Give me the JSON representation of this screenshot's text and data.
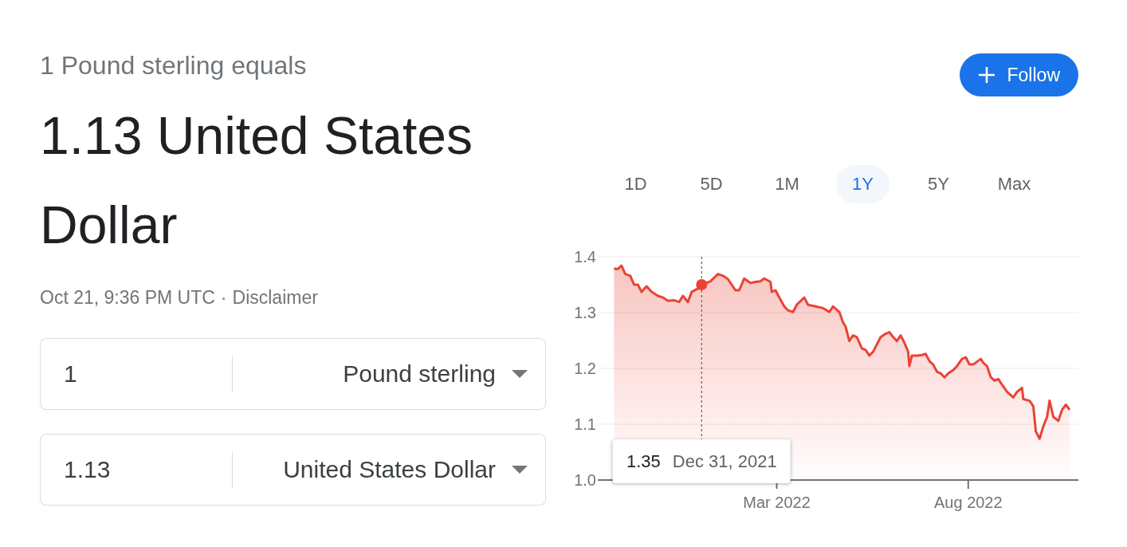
{
  "header": {
    "subtitle": "1 Pound sterling equals",
    "result": "1.13 United States Dollar",
    "updated": "Oct 21, 9:36 PM UTC",
    "separator": "·",
    "disclaimer": "Disclaimer"
  },
  "follow_button": {
    "label": "Follow"
  },
  "converter": [
    {
      "amount": "1",
      "currency": "Pound sterling"
    },
    {
      "amount": "1.13",
      "currency": "United States Dollar"
    }
  ],
  "range_tabs": [
    {
      "label": "1D",
      "selected": false
    },
    {
      "label": "5D",
      "selected": false
    },
    {
      "label": "1M",
      "selected": false
    },
    {
      "label": "1Y",
      "selected": true
    },
    {
      "label": "5Y",
      "selected": false
    },
    {
      "label": "Max",
      "selected": false
    }
  ],
  "chart": {
    "chart_data": {
      "type": "area",
      "x": [
        "2021-10-22",
        "2021-10-25",
        "2021-10-28",
        "2021-10-31",
        "2021-11-04",
        "2021-11-07",
        "2021-11-10",
        "2021-11-13",
        "2021-11-17",
        "2021-11-21",
        "2021-11-26",
        "2021-11-30",
        "2021-12-04",
        "2021-12-09",
        "2021-12-13",
        "2021-12-16",
        "2021-12-20",
        "2021-12-23",
        "2021-12-28",
        "2021-12-31",
        "2022-01-07",
        "2022-01-13",
        "2022-01-17",
        "2022-01-21",
        "2022-01-27",
        "2022-01-30",
        "2022-02-03",
        "2022-02-08",
        "2022-02-12",
        "2022-02-16",
        "2022-02-19",
        "2022-02-24",
        "2022-02-25",
        "2022-02-28",
        "2022-03-03",
        "2022-03-07",
        "2022-03-10",
        "2022-03-14",
        "2022-03-17",
        "2022-03-23",
        "2022-03-26",
        "2022-04-01",
        "2022-04-07",
        "2022-04-12",
        "2022-04-15",
        "2022-04-20",
        "2022-04-23",
        "2022-04-25",
        "2022-04-28",
        "2022-05-01",
        "2022-05-04",
        "2022-05-06",
        "2022-05-08",
        "2022-05-11",
        "2022-05-14",
        "2022-05-17",
        "2022-05-20",
        "2022-05-23",
        "2022-05-27",
        "2022-05-30",
        "2022-06-02",
        "2022-06-05",
        "2022-06-08",
        "2022-06-11",
        "2022-06-14",
        "2022-06-15",
        "2022-06-17",
        "2022-06-21",
        "2022-06-25",
        "2022-06-28",
        "2022-07-01",
        "2022-07-04",
        "2022-07-07",
        "2022-07-10",
        "2022-07-13",
        "2022-07-16",
        "2022-07-20",
        "2022-07-23",
        "2022-07-27",
        "2022-07-30",
        "2022-08-02",
        "2022-08-05",
        "2022-08-11",
        "2022-08-13",
        "2022-08-16",
        "2022-08-19",
        "2022-08-22",
        "2022-08-25",
        "2022-08-28",
        "2022-09-01",
        "2022-09-06",
        "2022-09-09",
        "2022-09-13",
        "2022-09-14",
        "2022-09-19",
        "2022-09-22",
        "2022-09-24",
        "2022-09-27",
        "2022-09-30",
        "2022-10-03",
        "2022-10-05",
        "2022-10-08",
        "2022-10-12",
        "2022-10-15",
        "2022-10-18",
        "2022-10-21"
      ],
      "series": [
        {
          "color": "#ea4335",
          "values": [
            1.379,
            1.378,
            1.384,
            1.369,
            1.366,
            1.35,
            1.35,
            1.337,
            1.347,
            1.337,
            1.33,
            1.327,
            1.321,
            1.322,
            1.319,
            1.33,
            1.319,
            1.337,
            1.343,
            1.35,
            1.356,
            1.369,
            1.366,
            1.36,
            1.34,
            1.34,
            1.361,
            1.353,
            1.355,
            1.356,
            1.361,
            1.355,
            1.337,
            1.34,
            1.327,
            1.311,
            1.304,
            1.301,
            1.314,
            1.327,
            1.314,
            1.311,
            1.308,
            1.301,
            1.311,
            1.301,
            1.282,
            1.275,
            1.249,
            1.259,
            1.256,
            1.246,
            1.236,
            1.233,
            1.223,
            1.23,
            1.243,
            1.256,
            1.262,
            1.265,
            1.256,
            1.249,
            1.259,
            1.246,
            1.23,
            1.204,
            1.223,
            1.223,
            1.224,
            1.226,
            1.213,
            1.207,
            1.194,
            1.191,
            1.184,
            1.191,
            1.197,
            1.204,
            1.217,
            1.22,
            1.207,
            1.207,
            1.217,
            1.21,
            1.204,
            1.184,
            1.178,
            1.181,
            1.171,
            1.158,
            1.148,
            1.158,
            1.165,
            1.145,
            1.142,
            1.132,
            1.087,
            1.074,
            1.096,
            1.113,
            1.142,
            1.113,
            1.106,
            1.126,
            1.135,
            1.126
          ]
        }
      ],
      "xlim": [
        "2021-10-09",
        "2022-10-28"
      ],
      "ylim": [
        1.0,
        1.4
      ],
      "xticks": [
        {
          "value": "2022-03-01",
          "label": "Mar 2022"
        },
        {
          "value": "2022-08-01",
          "label": "Aug 2022"
        }
      ],
      "yticks": [
        {
          "value": 1.0,
          "label": "1.0"
        },
        1.1,
        1.2,
        1.3,
        1.4
      ],
      "grid": true,
      "ref_lines": [
        {
          "axis": "x",
          "value": "2021-12-31"
        }
      ],
      "annotations": [
        "1.35",
        "Dec 31, 2021"
      ]
    }
  }
}
